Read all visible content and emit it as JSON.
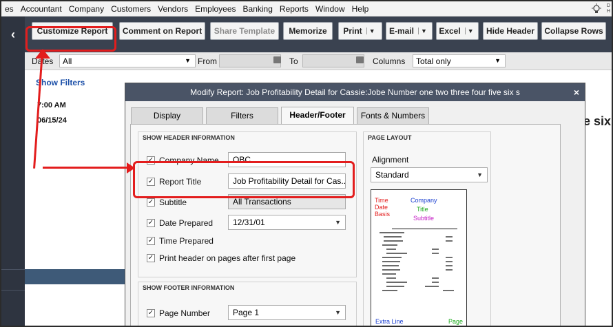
{
  "menubar": [
    "es",
    "Accountant",
    "Company",
    "Customers",
    "Vendors",
    "Employees",
    "Banking",
    "Reports",
    "Window",
    "Help"
  ],
  "tip_text": [
    "D",
    "H"
  ],
  "toolbar": {
    "customize": "Customize Report",
    "comment": "Comment on Report",
    "share": "Share Template",
    "memorize": "Memorize",
    "print": "Print",
    "email": "E-mail",
    "excel": "Excel",
    "hide_header": "Hide Header",
    "collapse_rows": "Collapse Rows"
  },
  "filterbar": {
    "dates_label": "Dates",
    "dates_value": "All",
    "from_label": "From",
    "to_label": "To",
    "columns_label": "Columns",
    "columns_value": "Total only"
  },
  "leftpanel": {
    "show_filters": "Show Filters",
    "time": "7:00 AM",
    "date": "06/15/24"
  },
  "report_fragment": "e six",
  "dialog": {
    "title": "Modify Report: Job Profitability Detail for Cassie:Jobe Number one two three four five six s",
    "close": "×",
    "tabs": [
      "Display",
      "Filters",
      "Header/Footer",
      "Fonts & Numbers"
    ],
    "active_tab": "Header/Footer",
    "show_header_title": "SHOW HEADER INFORMATION",
    "header_rows": [
      {
        "label": "Company Name",
        "value": "OBC",
        "checked": true
      },
      {
        "label": "Report Title",
        "value": "Job Profitability Detail for Cas...",
        "checked": true
      },
      {
        "label": "Subtitle",
        "value": "All Transactions",
        "checked": true
      },
      {
        "label": "Date Prepared",
        "value": "12/31/01",
        "checked": true
      },
      {
        "label": "Time Prepared",
        "checked": true
      },
      {
        "label": "Print header on pages after first page",
        "checked": true
      }
    ],
    "show_footer_title": "SHOW FOOTER INFORMATION",
    "footer_rows": [
      {
        "label": "Page Number",
        "value": "Page 1",
        "checked": true
      }
    ],
    "page_layout_title": "PAGE LAYOUT",
    "alignment_label": "Alignment",
    "alignment_value": "Standard",
    "preview": {
      "time": "Time",
      "date": "Date",
      "basis": "Basis",
      "company": "Company",
      "title": "Title",
      "subtitle": "Subtitle",
      "extra_line": "Extra Line",
      "page": "Page"
    }
  },
  "colors": {
    "annotation": "#e31d1d",
    "toolbar_bg": "#3a4250",
    "dialog_title_bg": "#4a5466"
  }
}
